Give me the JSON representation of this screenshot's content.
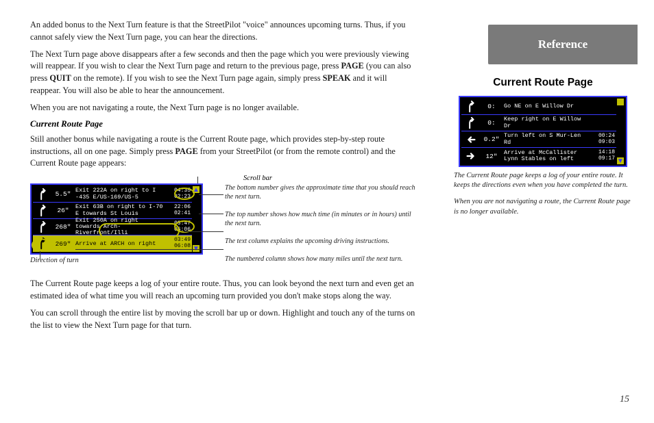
{
  "left": {
    "p1a": "An added bonus to the Next Turn feature is that the StreetPilot \"voice\" announces upcoming turns. Thus, if you cannot safely view the Next Turn page, you can hear the directions.",
    "p2_a": "The Next Turn page above disappears after a few seconds and then the page which you were previously viewing will reappear. If you wish to clear the Next Turn page and return to the previous page, press ",
    "p2_b": "PAGE",
    "p2_c": " (you can also press ",
    "p2_d": "QUIT",
    "p2_e": " on the remote). If you wish to see the Next Turn page again, simply press ",
    "p2_f": "SPEAK",
    "p2_g": " and it will reappear. You will also be able to hear the announcement.",
    "p3": "When you are not navigating a route, the Next Turn page is no longer available.",
    "subhead": "Current Route Page",
    "p4_a": "Still another bonus while navigating a route is the Current Route page, which provides step-by-step route instructions, all on one page. Simply press ",
    "p4_b": "PAGE",
    "p4_c": " from your StreetPilot (or from the remote control) and the Current Route page appears:",
    "scrollbar_label": "Scroll bar",
    "callout1": "The bottom number gives the approximate time that you should reach the next turn.",
    "callout2": "The top number shows how much time (in minutes or in hours) until the next turn.",
    "callout3": "The text column explains the upcoming driving instructions.",
    "callout4": "The numbered column shows how many miles until the next turn.",
    "direction_label": "Direction of turn",
    "p5": "The Current Route page keeps a log of your entire route. Thus, you can look beyond the next turn and even get an estimated idea of what time you will reach an upcoming turn provided you don't make stops along the way.",
    "p6": "You can scroll through the entire list by moving the scroll bar up or down. Highlight and touch any of the turns on the list to view the Next Turn page for that turn."
  },
  "left_gps": {
    "rows": [
      {
        "dir": "right-merge",
        "dist": "5.5\"",
        "instr": "Exit 222A on right to I -435 E/US-169/US-5",
        "t1": "04:35",
        "t2": "02:23"
      },
      {
        "dir": "right-merge",
        "dist": "26\"",
        "instr": "Exit 63B on right to I-70 E towards St Louis",
        "t1": "22:06",
        "t2": "02:41"
      },
      {
        "dir": "right-merge",
        "dist": "268\"",
        "instr": "Exit 250A on right towards Arch-Riverfront/Illi",
        "t1": "03:47",
        "t2": "06:06"
      },
      {
        "dir": "right-merge",
        "dist": "269\"",
        "instr": "Arrive at ARCH on right",
        "t1": "03:49",
        "t2": "06:08"
      }
    ]
  },
  "right": {
    "reference": "Reference",
    "title": "Current Route Page",
    "caption1": "The Current Route page keeps a log of your entire route. It keeps the directions even when you have completed the turn.",
    "caption2": "When you are not navigating a route, the Current Route page is no longer available.",
    "page_num": "15"
  },
  "right_gps": {
    "rows": [
      {
        "dir": "right-merge",
        "dist": "0:",
        "instr": "Go NE on E Willow Dr",
        "t1": "",
        "t2": ""
      },
      {
        "dir": "right-merge",
        "dist": "0:",
        "instr": "Keep right on E Willow Dr",
        "t1": "",
        "t2": ""
      },
      {
        "dir": "left",
        "dist": "0.2\"",
        "instr": "Turn left on S Mur-Len Rd",
        "t1": "00:24",
        "t2": "09:03"
      },
      {
        "dir": "right",
        "dist": "12\"",
        "instr": "Arrive at McCallister Lynn Stables on left",
        "t1": "14:18",
        "t2": "09:17"
      }
    ]
  }
}
